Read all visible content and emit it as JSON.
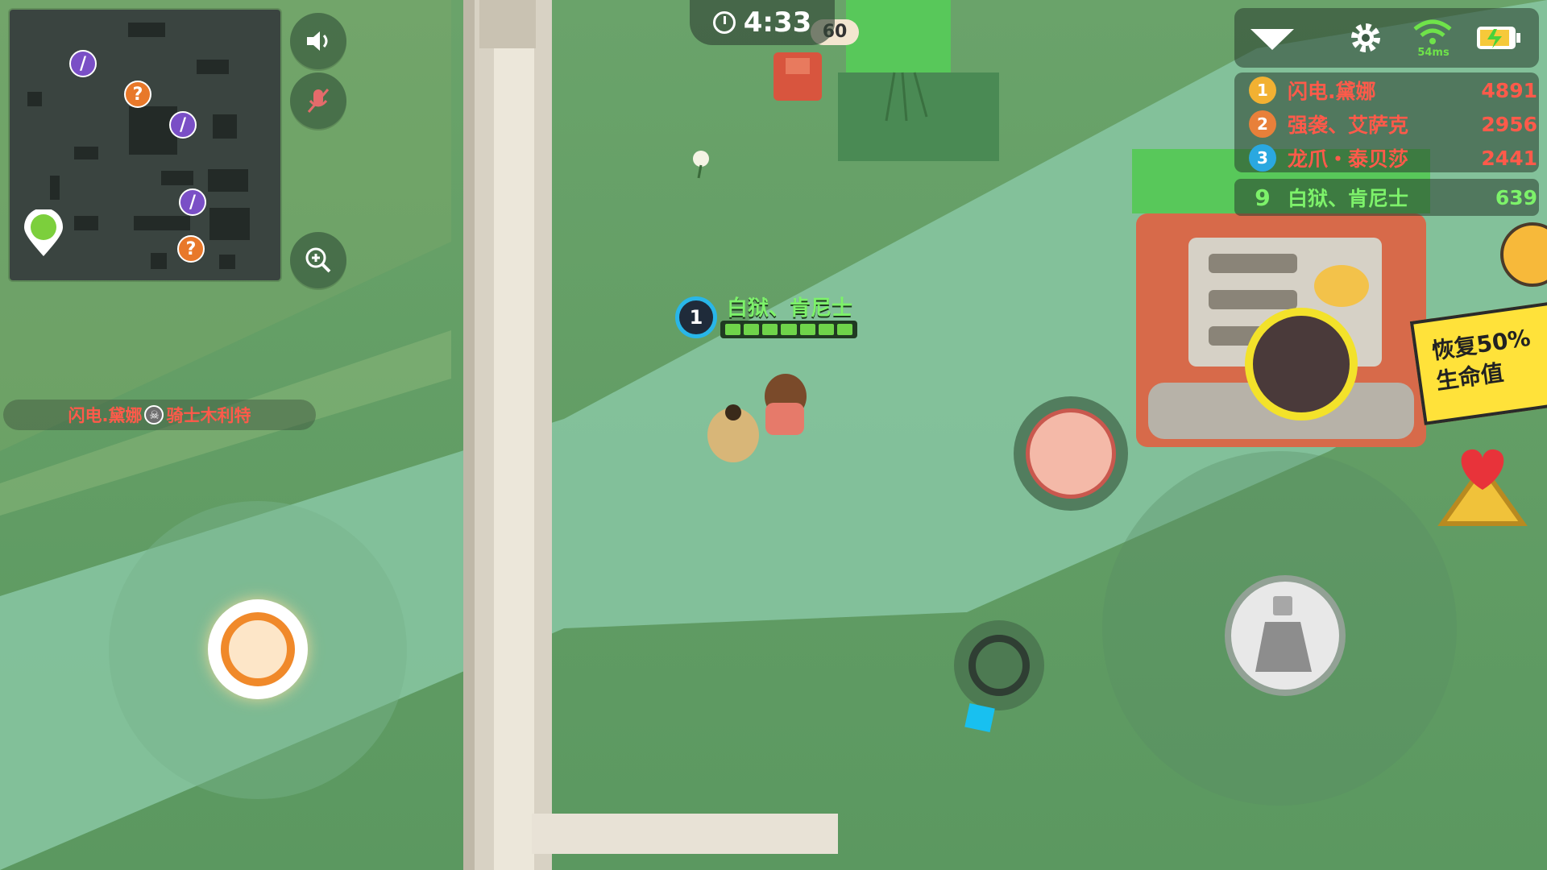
{
  "timer": {
    "value": "4:33"
  },
  "topbar": {
    "ping": "54ms"
  },
  "leaderboard": [
    {
      "rank": "1",
      "name": "闪电.黛娜",
      "score": "4891"
    },
    {
      "rank": "2",
      "name": "强袭、艾萨克",
      "score": "2956"
    },
    {
      "rank": "3",
      "name": "龙爪・泰贝莎",
      "score": "2441"
    }
  ],
  "self_rank": {
    "rank": "9",
    "name": "白狱、肯尼士",
    "score": "639"
  },
  "kill_feed": {
    "killer": "闪电.黛娜",
    "victim": "骑士木利特"
  },
  "player": {
    "level": "1",
    "name": "白狱、肯尼士",
    "hp_segments": 7
  },
  "tooltip": {
    "text": "恢复50%生命值"
  },
  "objects": {
    "crate_number": "60"
  },
  "icons": {
    "sound": "speaker-icon",
    "mic": "mic-off-icon",
    "zoom": "zoom-in-icon",
    "settings": "gear-icon",
    "wifi": "wifi-icon",
    "battery": "battery-charging-icon",
    "dropdown": "chevron-down-icon"
  },
  "colors": {
    "ground": "#5d9b63",
    "path": "#86c4a0",
    "enemy_name": "#ff5a4a",
    "self_name": "#7df26a",
    "accent": "#f0892a"
  }
}
